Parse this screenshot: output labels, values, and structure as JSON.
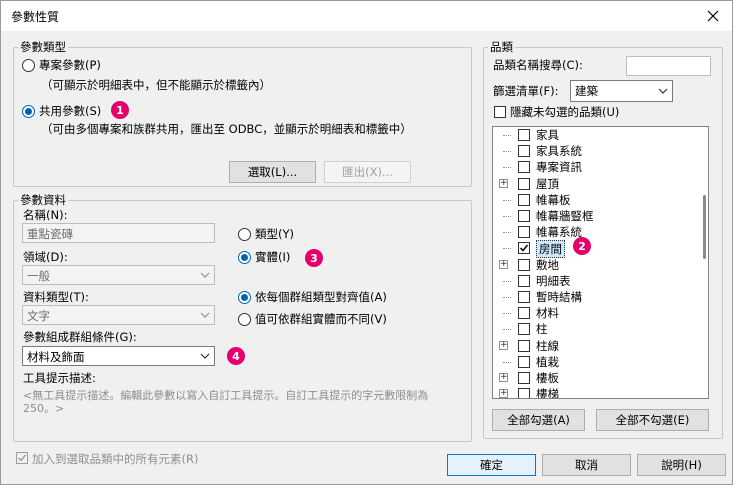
{
  "window": {
    "title": "參數性質"
  },
  "param_type": {
    "legend": "參數類型",
    "project_label": "專案參數(P)",
    "project_desc": "（可顯示於明細表中，但不能顯示於標籤內）",
    "shared_label": "共用參數(S)",
    "shared_desc": "（可由多個專案和族群共用，匯出至 ODBC，並顯示於明細表和標籤中）",
    "select_btn": "選取(L)...",
    "export_btn": "匯出(X)..."
  },
  "param_data": {
    "legend": "參數資料",
    "name_label": "名稱(N):",
    "name_value": "重點瓷磚",
    "domain_label": "領域(D):",
    "domain_value": "一般",
    "datatype_label": "資料類型(T):",
    "datatype_value": "文字",
    "group_label": "參數組成群組條件(G):",
    "group_value": "材料及飾面",
    "type_label": "類型(Y)",
    "instance_label": "實體(I)",
    "align_label": "依每個群組類型對齊值(A)",
    "vary_label": "值可依群組實體而不同(V)",
    "tooltip_label": "工具提示描述:",
    "tooltip_text_line1": "<無工具提示描述。編輯此參數以寫入自訂工具提示。自訂工具提示的字元數限制為",
    "tooltip_text_line2": "250。>"
  },
  "categories": {
    "legend": "品類",
    "search_label": "品類名稱搜尋(C):",
    "search_value": "",
    "filter_label": "篩選清單(F):",
    "filter_value": "建築",
    "hide_label": "隱藏未勾選的品類(U)",
    "items": [
      {
        "label": "家具",
        "checked": false,
        "expandable": false
      },
      {
        "label": "家具系統",
        "checked": false,
        "expandable": false
      },
      {
        "label": "專案資訊",
        "checked": false,
        "expandable": false
      },
      {
        "label": "屋頂",
        "checked": false,
        "expandable": true
      },
      {
        "label": "帷幕板",
        "checked": false,
        "expandable": false
      },
      {
        "label": "帷幕牆豎框",
        "checked": false,
        "expandable": false
      },
      {
        "label": "帷幕系統",
        "checked": false,
        "expandable": false
      },
      {
        "label": "房間",
        "checked": true,
        "expandable": false
      },
      {
        "label": "敷地",
        "checked": false,
        "expandable": true
      },
      {
        "label": "明細表",
        "checked": false,
        "expandable": false
      },
      {
        "label": "暫時結構",
        "checked": false,
        "expandable": false
      },
      {
        "label": "材料",
        "checked": false,
        "expandable": false
      },
      {
        "label": "柱",
        "checked": false,
        "expandable": false
      },
      {
        "label": "柱線",
        "checked": false,
        "expandable": true
      },
      {
        "label": "植栽",
        "checked": false,
        "expandable": false
      },
      {
        "label": "樓板",
        "checked": false,
        "expandable": true
      },
      {
        "label": "樓梯",
        "checked": false,
        "expandable": true
      }
    ],
    "check_all_btn": "全部勾選(A)",
    "uncheck_all_btn": "全部不勾選(E)"
  },
  "footer": {
    "add_all_label": "加入到選取品類中的所有元素(R)",
    "ok_btn": "確定",
    "cancel_btn": "取消",
    "help_btn": "說明(H)"
  },
  "badges": {
    "b1": "1",
    "b2": "2",
    "b3": "3",
    "b4": "4"
  },
  "colors": {
    "accent": "#0063b1",
    "badge": "#e3006d"
  }
}
